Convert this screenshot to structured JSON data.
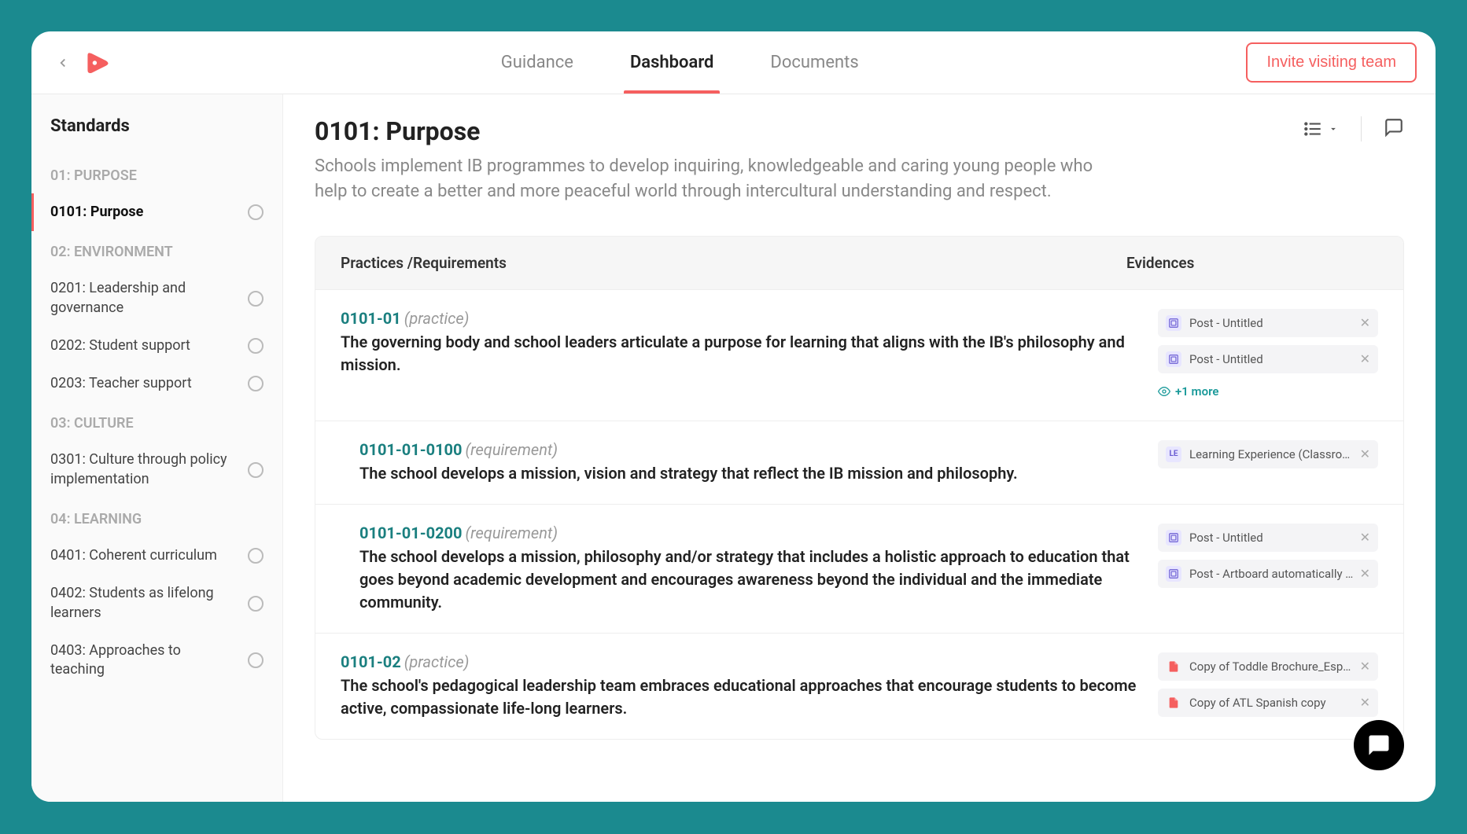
{
  "header": {
    "nav_tabs": [
      "Guidance",
      "Dashboard",
      "Documents"
    ],
    "active_tab": 1,
    "invite_label": "Invite visiting team"
  },
  "sidebar": {
    "title": "Standards",
    "sections": [
      {
        "header": "01: PURPOSE",
        "items": [
          {
            "label": "0101: Purpose",
            "active": true
          }
        ]
      },
      {
        "header": "02: ENVIRONMENT",
        "items": [
          {
            "label": "0201: Leadership and governance"
          },
          {
            "label": "0202: Student support"
          },
          {
            "label": "0203: Teacher support"
          }
        ]
      },
      {
        "header": "03: CULTURE",
        "items": [
          {
            "label": "0301: Culture through policy implementation"
          }
        ]
      },
      {
        "header": "04: LEARNING",
        "items": [
          {
            "label": "0401: Coherent curriculum"
          },
          {
            "label": "0402: Students as lifelong learners"
          },
          {
            "label": "0403: Approaches to teaching"
          }
        ]
      }
    ]
  },
  "page": {
    "title": "0101: Purpose",
    "description": "Schools implement IB programmes to develop inquiring, knowledgeable and caring young people who help to create a better and more peaceful world through intercultural understanding and respect."
  },
  "table": {
    "col_practices": "Practices /Requirements",
    "col_evidences": "Evidences",
    "rows": [
      {
        "code": "0101-01",
        "type": "(practice)",
        "desc": "The governing body and school leaders articulate a purpose for learning that aligns with the IB's philosophy and mission.",
        "sub": false,
        "evidences": [
          {
            "kind": "post",
            "label": "Post - Untitled"
          },
          {
            "kind": "post",
            "label": "Post - Untitled"
          }
        ],
        "more": "+1 more"
      },
      {
        "code": "0101-01-0100",
        "type": "(requirement)",
        "desc": "The school develops a mission, vision and strategy that reflect the IB mission and philosophy.",
        "sub": true,
        "evidences": [
          {
            "kind": "le",
            "label": "Learning Experience (Classroom..."
          }
        ]
      },
      {
        "code": "0101-01-0200",
        "type": "(requirement)",
        "desc": "The school develops a mission, philosophy and/or strategy that includes a holistic approach to education that goes beyond academic development and encourages awareness beyond the individual and the immediate community.",
        "sub": true,
        "evidences": [
          {
            "kind": "post",
            "label": "Post - Untitled"
          },
          {
            "kind": "post",
            "label": "Post - Artboard automatically shi..."
          }
        ]
      },
      {
        "code": "0101-02",
        "type": "(practice)",
        "desc": "The school's pedagogical leadership team embraces educational approaches that encourage students to become active, compassionate life-long learners.",
        "sub": false,
        "evidences": [
          {
            "kind": "pdf",
            "label": "Copy of Toddle Brochure_Español"
          },
          {
            "kind": "pdf",
            "label": "Copy of ATL Spanish copy"
          }
        ]
      }
    ]
  },
  "icons": {
    "le_badge": "LE"
  }
}
